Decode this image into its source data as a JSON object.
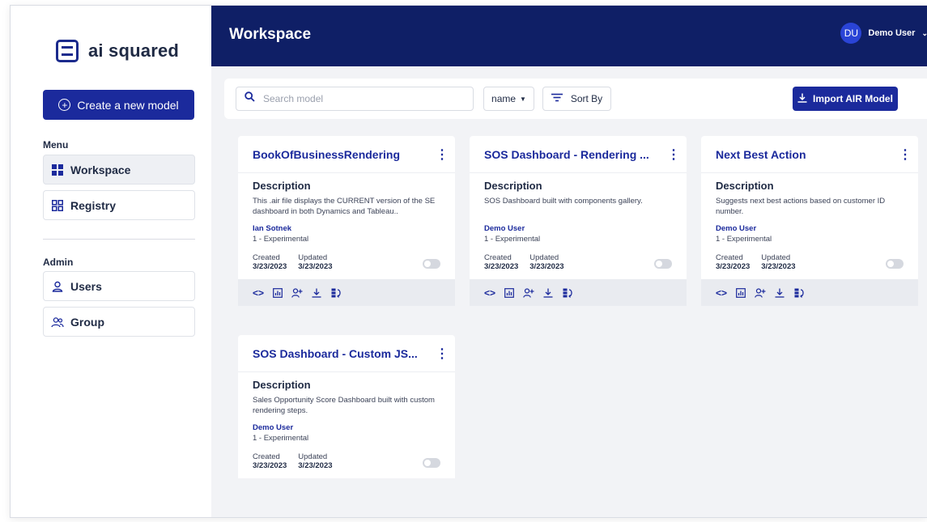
{
  "app": {
    "name": "ai squared"
  },
  "sidebar": {
    "create_label": "Create a new model",
    "menu_title": "Menu",
    "menu_items": [
      {
        "label": "Workspace",
        "icon": "grid-icon",
        "active": true
      },
      {
        "label": "Registry",
        "icon": "registry-icon",
        "active": false
      }
    ],
    "admin_title": "Admin",
    "admin_items": [
      {
        "label": "Users",
        "icon": "user-icon"
      },
      {
        "label": "Group",
        "icon": "group-icon"
      }
    ]
  },
  "header": {
    "title": "Workspace",
    "user_initials": "DU",
    "user_name": "Demo User"
  },
  "toolbar": {
    "search_placeholder": "Search model",
    "sort_field": "name",
    "sort_label": "Sort By",
    "import_label": "Import AIR Model"
  },
  "cards": [
    {
      "title": "BookOfBusinessRendering",
      "desc_title": "Description",
      "description": "This .air file displays the CURRENT version of the SE dashboard in both Dynamics and Tableau..",
      "author": "Ian Sotnek",
      "stage": "1 - Experimental",
      "created_label": "Created",
      "updated_label": "Updated",
      "created": "3/23/2023",
      "updated": "3/23/2023"
    },
    {
      "title": "SOS Dashboard - Rendering ...",
      "desc_title": "Description",
      "description": "SOS Dashboard built with components gallery.",
      "author": "Demo User",
      "stage": "1 - Experimental",
      "created_label": "Created",
      "updated_label": "Updated",
      "created": "3/23/2023",
      "updated": "3/23/2023"
    },
    {
      "title": "Next Best Action",
      "desc_title": "Description",
      "description": "Suggests next best actions based on customer ID number.",
      "author": "Demo User",
      "stage": "1 - Experimental",
      "created_label": "Created",
      "updated_label": "Updated",
      "created": "3/23/2023",
      "updated": "3/23/2023"
    },
    {
      "title": "SOS Dashboard - Custom JS...",
      "desc_title": "Description",
      "description": "Sales Opportunity Score Dashboard built with custom rendering steps.",
      "author": "Demo User",
      "stage": "1 - Experimental",
      "created_label": "Created",
      "updated_label": "Updated",
      "created": "3/23/2023",
      "updated": "3/23/2023"
    }
  ],
  "colors": {
    "primary": "#1b2a9c",
    "header_bg": "#0f1f66",
    "page_bg": "#f2f3f6"
  }
}
